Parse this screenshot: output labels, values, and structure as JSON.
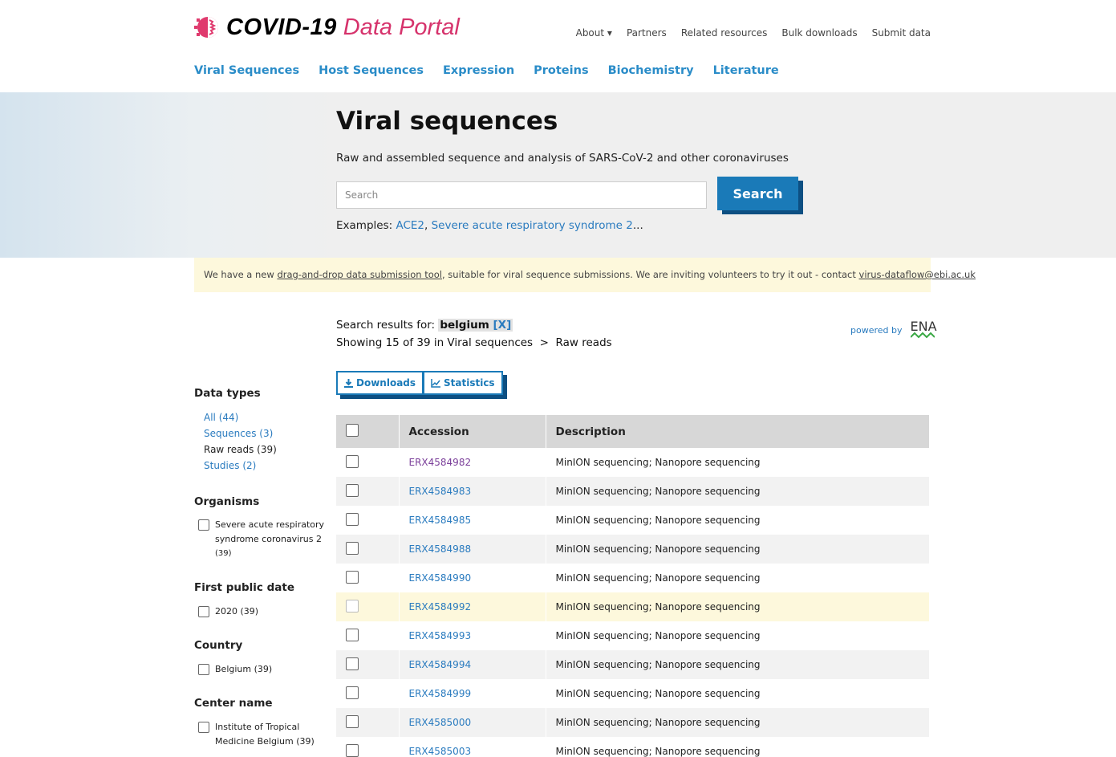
{
  "header": {
    "logo_bold": "COVID-19",
    "logo_light": "Data Portal",
    "topnav": [
      "About ▾",
      "Partners",
      "Related resources",
      "Bulk downloads",
      "Submit data"
    ],
    "mainnav": [
      "Viral Sequences",
      "Host Sequences",
      "Expression",
      "Proteins",
      "Biochemistry",
      "Literature"
    ]
  },
  "hero": {
    "title": "Viral sequences",
    "subtitle": "Raw and assembled sequence and analysis of SARS-CoV-2 and other coronaviruses",
    "search_placeholder": "Search",
    "search_button": "Search",
    "examples_label": "Examples:",
    "example1": "ACE2",
    "example2": "Severe acute respiratory syndrome 2",
    "ellipsis": "..."
  },
  "notice": {
    "prefix": "We have a new ",
    "link": "drag-and-drop data submission tool",
    "middle": ", suitable for viral sequence submissions. We are inviting volunteers to try it out - contact ",
    "email": "virus-dataflow@ebi.ac.uk"
  },
  "results": {
    "label": "Search results for:",
    "term": "belgium",
    "clear": "[X]",
    "showing": "Showing 15 of 39 in Viral sequences  >  Raw reads",
    "powered_by": "powered by",
    "ena": "ENA",
    "downloads_button": "Downloads",
    "statistics_button": "Statistics"
  },
  "sidebar": {
    "data_types_heading": "Data types",
    "data_types": [
      "All (44)",
      "Sequences (3)",
      "Raw reads (39)",
      "Studies (2)"
    ],
    "organisms_heading": "Organisms",
    "organism_line1": "Severe acute respiratory",
    "organism_line2": "syndrome coronavirus 2",
    "organism_line3": "(39)",
    "first_public_heading": "First public date",
    "first_public_item": "2020 (39)",
    "country_heading": "Country",
    "country_item": "Belgium (39)",
    "center_heading": "Center name",
    "center_line1": "Institute of Tropical",
    "center_line2": "Medicine Belgium (39)"
  },
  "table": {
    "headers": [
      "Accession",
      "Description"
    ],
    "rows": [
      {
        "accession": "ERX4584982",
        "description": "MinION sequencing; Nanopore sequencing"
      },
      {
        "accession": "ERX4584983",
        "description": "MinION sequencing; Nanopore sequencing"
      },
      {
        "accession": "ERX4584985",
        "description": "MinION sequencing; Nanopore sequencing"
      },
      {
        "accession": "ERX4584988",
        "description": "MinION sequencing; Nanopore sequencing"
      },
      {
        "accession": "ERX4584990",
        "description": "MinION sequencing; Nanopore sequencing"
      },
      {
        "accession": "ERX4584992",
        "description": "MinION sequencing; Nanopore sequencing"
      },
      {
        "accession": "ERX4584993",
        "description": "MinION sequencing; Nanopore sequencing"
      },
      {
        "accession": "ERX4584994",
        "description": "MinION sequencing; Nanopore sequencing"
      },
      {
        "accession": "ERX4584999",
        "description": "MinION sequencing; Nanopore sequencing"
      },
      {
        "accession": "ERX4585000",
        "description": "MinION sequencing; Nanopore sequencing"
      },
      {
        "accession": "ERX4585003",
        "description": "MinION sequencing; Nanopore sequencing"
      }
    ]
  },
  "colors": {
    "accent": "#1a7ab8",
    "link": "#2a7bbf",
    "logo_pink": "#d6336c",
    "notice_bg": "#fdf8dc"
  }
}
